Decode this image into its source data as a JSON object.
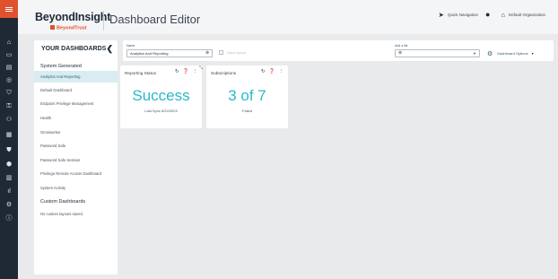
{
  "rail": {
    "items": [
      {
        "icon": "home-icon",
        "glyph": "⌂"
      },
      {
        "icon": "monitor-icon",
        "glyph": "▭"
      },
      {
        "icon": "clipboard-icon",
        "glyph": "▤"
      },
      {
        "icon": "radar-icon",
        "glyph": "◎"
      },
      {
        "icon": "shield-icon",
        "glyph": "⛉"
      },
      {
        "icon": "key-icon",
        "glyph": "⚿"
      },
      {
        "icon": "user-chart-icon",
        "glyph": "⚇"
      },
      {
        "icon": "chart-icon",
        "glyph": "▦"
      },
      {
        "icon": "shield-check-icon",
        "glyph": "⛊"
      },
      {
        "icon": "badge-icon",
        "glyph": "⬢"
      },
      {
        "icon": "server-icon",
        "glyph": "▥"
      },
      {
        "icon": "bar-chart-icon",
        "glyph": "ıl"
      },
      {
        "icon": "settings-icon",
        "glyph": "⚙"
      },
      {
        "icon": "info-icon",
        "glyph": "ⓘ"
      }
    ]
  },
  "header": {
    "logo_title": "BeyondInsight",
    "logo_sub": "BeyondTrust",
    "page_title": "Dashboard Editor",
    "quick_navigation": "Quick Navigation",
    "organization": "Default Organization"
  },
  "sidebar": {
    "heading": "YOUR DASHBOARDS",
    "collapse_glyph": "❮",
    "system_group": "System Generated",
    "system_items": [
      "Analytics And Reporting",
      "Default Dashboard",
      "Endpoint Privilege Management",
      "Health",
      "Omniworker",
      "Password Safe",
      "Password Safe Session",
      "Privilege Remote Access Dashboard",
      "System Activity"
    ],
    "custom_group": "Custom Dashboards",
    "custom_empty": "No custom layouts saved."
  },
  "toolbar": {
    "name_label": "Name",
    "name_value": "Analytics And Reporting",
    "clear_glyph": "⊗",
    "save_layout": "Save layout",
    "add_tile_label": "Add a tile",
    "dashboard_options": "Dashboard Options"
  },
  "tiles": [
    {
      "title": "Reporting Status",
      "value": "Success",
      "caption": "Last Sync 6/22/2023"
    },
    {
      "title": "Subscriptions",
      "value": "3 of 7",
      "caption": "Failed"
    }
  ],
  "colors": {
    "rail": "#1f2935",
    "brand": "#e0522d",
    "accent": "#2ab9c9",
    "active_item": "#d9ecf1"
  }
}
